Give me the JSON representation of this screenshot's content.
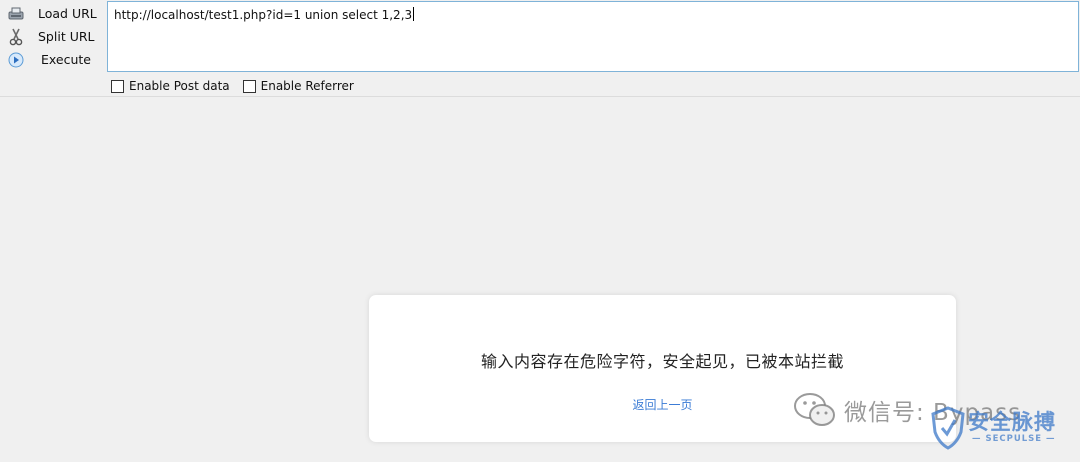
{
  "sidebar": {
    "load_url": "Load URL",
    "split_url": "Split URL",
    "execute": "Execute"
  },
  "url_input": {
    "value": "http://localhost/test1.php?id=1 union select 1,2,3"
  },
  "options": {
    "post_data": "Enable Post data",
    "referrer": "Enable Referrer"
  },
  "alert": {
    "message": "输入内容存在危险字符，安全起见，已被本站拦截",
    "back_link": "返回上一页"
  },
  "watermark": {
    "text": "微信号: Bypass",
    "logo_cn": "安全脉搏",
    "logo_en": "— SECPULSE —"
  },
  "colors": {
    "link": "#3a7bd5",
    "input_border": "#7fb3d8",
    "page_bg": "#f0f0f0"
  },
  "icons": [
    "load-url-icon",
    "split-url-icon",
    "execute-icon",
    "wechat-icon",
    "shield-icon"
  ]
}
